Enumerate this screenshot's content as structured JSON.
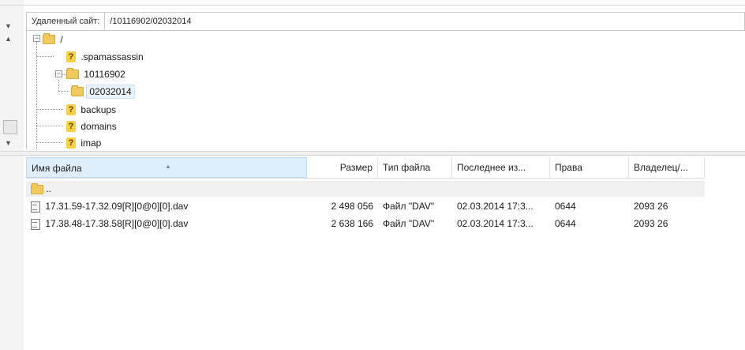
{
  "remote_site": {
    "label": "Удаленный сайт:",
    "path": "/10116902/02032014"
  },
  "tree": {
    "root": "/",
    "items": [
      {
        "label": ".spamassassin",
        "icon": "unknown-folder-icon"
      },
      {
        "label": "10116902",
        "icon": "folder-icon"
      },
      {
        "label": "02032014",
        "icon": "folder-icon",
        "selected": true
      },
      {
        "label": "backups",
        "icon": "unknown-folder-icon"
      },
      {
        "label": "domains",
        "icon": "unknown-folder-icon"
      },
      {
        "label": "imap",
        "icon": "unknown-folder-icon"
      }
    ]
  },
  "file_list": {
    "columns": [
      "Имя файла",
      "Размер",
      "Тип файла",
      "Последнее из...",
      "Права",
      "Владелец/..."
    ],
    "parent_dir": "..",
    "rows": [
      {
        "name": "17.31.59-17.32.09[R][0@0][0].dav",
        "size": "2 498 056",
        "type": "Файл \"DAV\"",
        "modified": "02.03.2014 17:3...",
        "perms": "0644",
        "owner": "2093 26"
      },
      {
        "name": "17.38.48-17.38.58[R][0@0][0].dav",
        "size": "2 638 166",
        "type": "Файл \"DAV\"",
        "modified": "02.03.2014 17:3...",
        "perms": "0644",
        "owner": "2093 26"
      }
    ]
  },
  "colors": {
    "folder": "#f2c95c",
    "selection": "#eaf3fb",
    "header_sorted": "#dfeefb"
  }
}
